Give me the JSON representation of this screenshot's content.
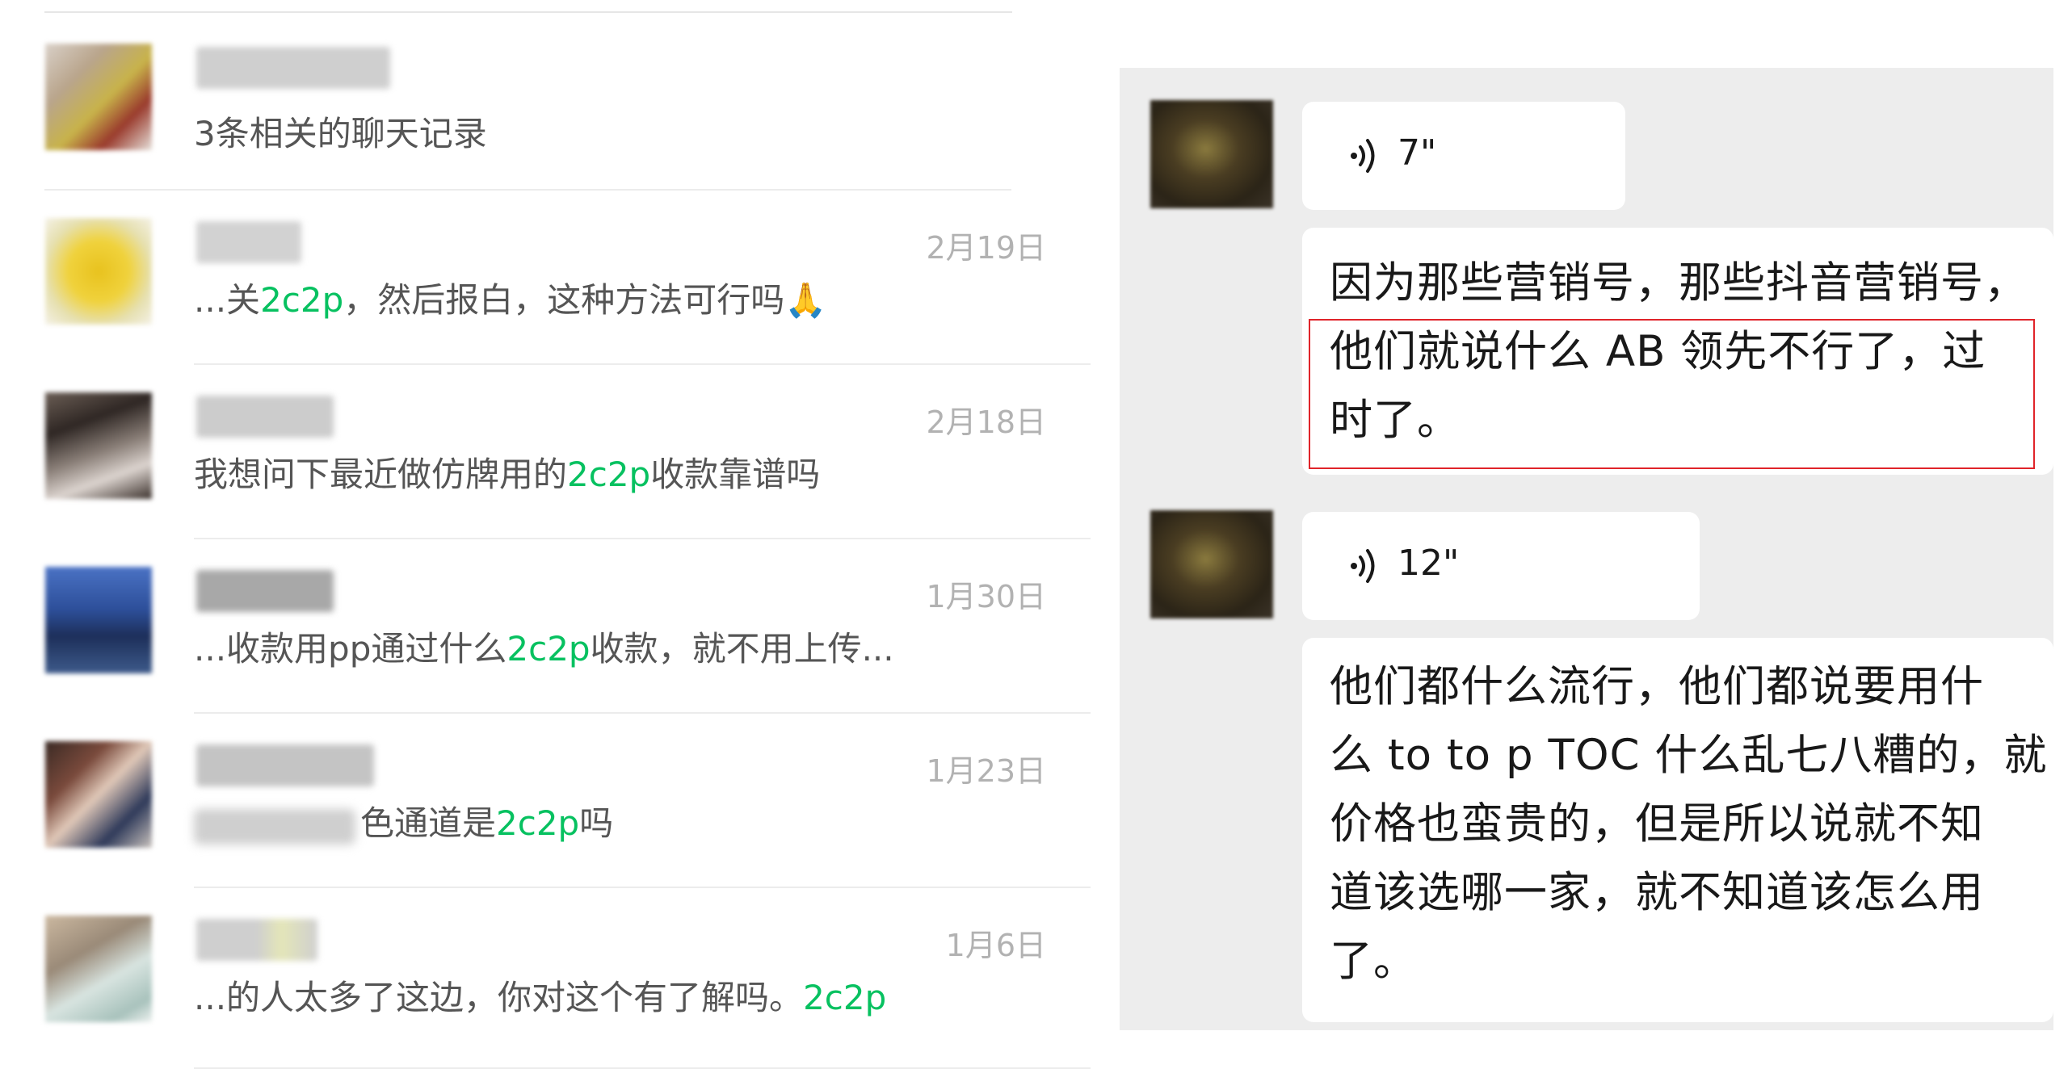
{
  "search_results": {
    "items": [
      {
        "date": "",
        "snippet_parts": [
          {
            "text": "3条相关的聊天记录",
            "hl": false
          }
        ]
      },
      {
        "date": "2月19日",
        "snippet_parts": [
          {
            "text": "...关",
            "hl": false
          },
          {
            "text": "2c2p",
            "hl": true
          },
          {
            "text": "，然后报白，这种方法可行吗",
            "hl": false
          }
        ],
        "trailing_emoji": "🙏"
      },
      {
        "date": "2月18日",
        "snippet_parts": [
          {
            "text": "我想问下最近做仿牌用的",
            "hl": false
          },
          {
            "text": "2c2p",
            "hl": true
          },
          {
            "text": "收款靠谱吗",
            "hl": false
          }
        ]
      },
      {
        "date": "1月30日",
        "snippet_parts": [
          {
            "text": "...收款用pp通过什么",
            "hl": false
          },
          {
            "text": "2c2p",
            "hl": true
          },
          {
            "text": "收款，就不用上传...",
            "hl": false
          }
        ]
      },
      {
        "date": "1月23日",
        "snippet_parts": [
          {
            "text": "色通道是",
            "hl": false
          },
          {
            "text": "2c2p",
            "hl": true
          },
          {
            "text": "吗",
            "hl": false
          }
        ]
      },
      {
        "date": "1月6日",
        "snippet_parts": [
          {
            "text": "...的人太多了这边，你对这个有了解吗。",
            "hl": false
          },
          {
            "text": "2c2p",
            "hl": true
          }
        ]
      }
    ]
  },
  "chat": {
    "messages": [
      {
        "type": "voice",
        "duration": "7\""
      },
      {
        "type": "text",
        "lines": [
          "因为那些营销号，那些抖音营销号，",
          "他们就说什么 AB 领先不行了，过",
          "时了。"
        ]
      },
      {
        "type": "voice",
        "duration": "12\""
      },
      {
        "type": "text",
        "lines": [
          "他们都什么流行，他们都说要用什",
          "么 to to p TOC 什么乱七八糟的，就",
          "价格也蛮贵的，但是所以说就不知",
          "道该选哪一家，就不知道该怎么用",
          "了。"
        ]
      }
    ]
  },
  "colors": {
    "highlight": "#07c160",
    "chat_bg": "#ededed",
    "annotation_box": "#e0242a"
  }
}
